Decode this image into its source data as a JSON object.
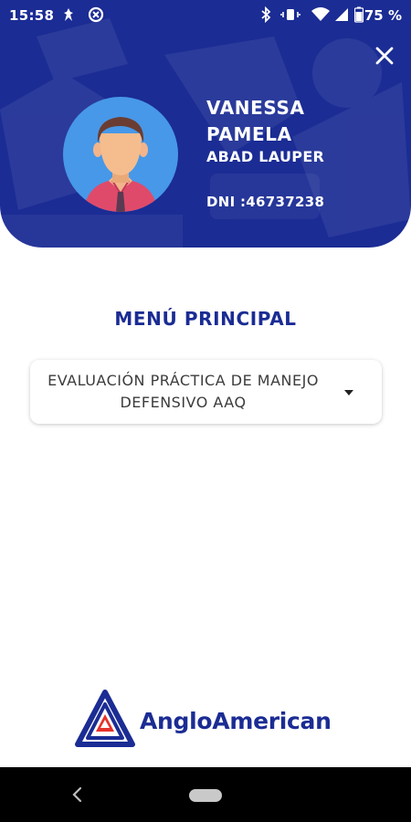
{
  "status_bar": {
    "time": "15:58",
    "battery_percent": "75 %",
    "icons": [
      "notification-app-icon",
      "data-saver-icon",
      "bluetooth-icon",
      "vibrate-icon",
      "wifi-icon",
      "signal-icon",
      "battery-icon"
    ]
  },
  "profile": {
    "first_names": "VANESSA\nPAMELA",
    "last_names": "ABAD LAUPER",
    "dni": "DNI :46737238"
  },
  "menu": {
    "title": "MENÚ PRINCIPAL",
    "selected_option": "EVALUACIÓN PRÁCTICA DE MANEJO DEFENSIVO AAQ"
  },
  "brand": {
    "logo_text": "AngloAmerican",
    "primary_color": "#1b2c94",
    "accent_color": "#e4322b"
  },
  "icons": {
    "close": "close-icon",
    "dropdown": "caret-down-icon",
    "nav_back": "back-icon",
    "nav_home": "home-pill-icon"
  }
}
